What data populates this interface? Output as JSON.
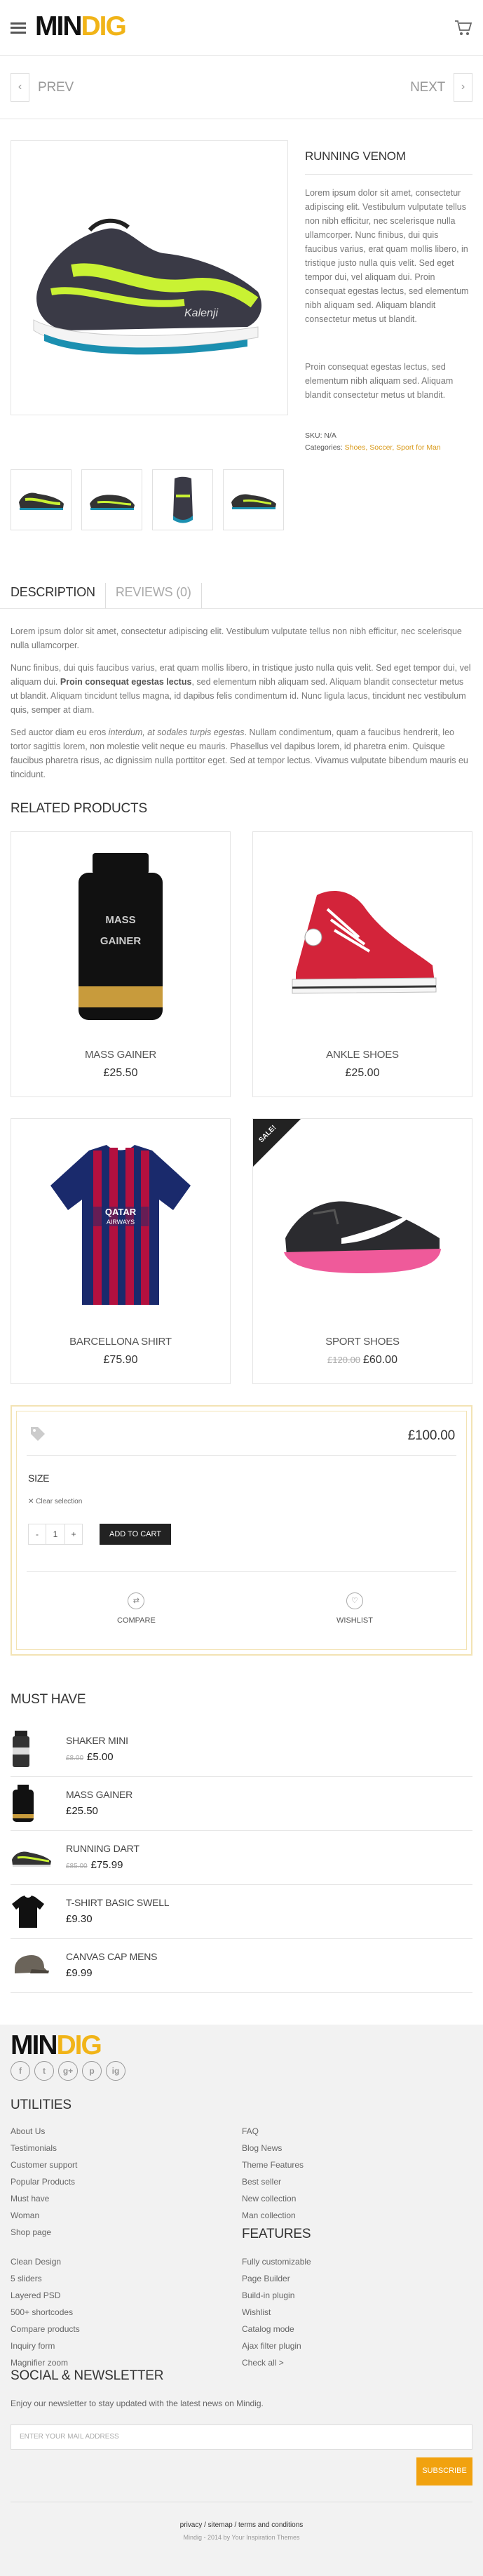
{
  "header": {
    "logo_a": "MIN",
    "logo_b": "DIG",
    "menu_icon": "hamburger-icon",
    "cart_icon": "shopping-cart-icon"
  },
  "nav": {
    "prev": "PREV",
    "next": "NEXT"
  },
  "product": {
    "title": "RUNNING VENOM",
    "desc1": "Lorem ipsum dolor sit amet, consectetur adipiscing elit. Vestibulum vulputate tellus non nibh efficitur, nec scelerisque nulla ullamcorper. Nunc finibus, dui quis faucibus varius, erat quam mollis libero, in tristique justo nulla quis velit. Sed eget tempor dui, vel aliquam dui. Proin consequat egestas lectus, sed elementum nibh aliquam sed. Aliquam blandit consectetur metus ut blandit.",
    "desc2": "Proin consequat egestas lectus, sed elementum nibh aliquam sed. Aliquam blandit consectetur metus ut blandit.",
    "sku_label": "SKU: N/A",
    "cat_label": "Categories:",
    "categories": "Shoes, Soccer, Sport for Man"
  },
  "tabs": {
    "description": "DESCRIPTION",
    "reviews": "REVIEWS (0)"
  },
  "description": {
    "p1": "Lorem ipsum dolor sit amet, consectetur adipiscing elit. Vestibulum vulputate tellus non nibh efficitur, nec scelerisque nulla ullamcorper.",
    "p2a": "Nunc finibus, dui quis faucibus varius, erat quam mollis libero, in tristique justo nulla quis velit. Sed eget tempor dui, vel aliquam dui. ",
    "p2b": "Proin consequat egestas lectus",
    "p2c": ", sed elementum nibh aliquam sed. Aliquam blandit consectetur metus ut blandit. Aliquam tincidunt tellus magna, id dapibus felis condimentum id. Nunc ligula lacus, tincidunt nec vestibulum quis, semper at diam.",
    "p3a": "Sed auctor diam eu eros ",
    "p3b": "interdum, at sodales turpis egestas",
    "p3c": ". Nullam condimentum, quam a faucibus hendrerit, leo tortor sagittis lorem, non molestie velit neque eu mauris. Phasellus vel dapibus lorem, id pharetra enim. Quisque faucibus pharetra risus, ac dignissim nulla porttitor eget. Sed at tempor lectus. Vivamus vulputate bibendum mauris eu tincidunt."
  },
  "related": {
    "title": "RELATED PRODUCTS",
    "items": [
      {
        "name": "MASS GAINER",
        "price": "£25.50"
      },
      {
        "name": "ANKLE SHOES",
        "price": "£25.00"
      },
      {
        "name": "BARCELLONA SHIRT",
        "price": "£75.90"
      },
      {
        "name": "SPORT SHOES",
        "old_price": "£120.00",
        "price": "£60.00",
        "badge": "SALE!"
      }
    ]
  },
  "buy": {
    "price": "£100.00",
    "size_label": "SIZE",
    "clear": "✕ Clear selection",
    "qty": "1",
    "minus": "-",
    "plus": "+",
    "add_to_cart": "ADD TO CART",
    "compare": "COMPARE",
    "wishlist": "WISHLIST"
  },
  "must_have": {
    "title": "MUST HAVE",
    "items": [
      {
        "name": "SHAKER MINI",
        "old_price": "£8.00",
        "price": "£5.00"
      },
      {
        "name": "MASS GAINER",
        "old_price": "",
        "price": "£25.50"
      },
      {
        "name": "RUNNING DART",
        "old_price": "£85.00",
        "price": "£75.99"
      },
      {
        "name": "T-SHIRT BASIC SWELL",
        "old_price": "",
        "price": "£9.30"
      },
      {
        "name": "CANVAS CAP MENS",
        "old_price": "",
        "price": "£9.99"
      }
    ]
  },
  "footer": {
    "logo_a": "MIN",
    "logo_b": "DIG",
    "social": [
      "f",
      "t",
      "g+",
      "p",
      "ig"
    ],
    "utilities_title": "UTILITIES",
    "col1": [
      "About Us",
      "Testimonials",
      "Customer support",
      "Popular Products",
      "Must have",
      "Woman",
      "Shop page"
    ],
    "col2": [
      "FAQ",
      "Blog News",
      "Theme Features",
      "Best seller",
      "New collection",
      "Man collection"
    ],
    "features_title": "FEATURES",
    "col3": [
      "Clean Design",
      "5 sliders",
      "Layered PSD",
      "500+ shortcodes",
      "Compare products",
      "Inquiry form",
      "Magnifier zoom"
    ],
    "col4": [
      "Fully customizable",
      "Page Builder",
      "Build-in plugin",
      "Wishlist",
      "Catalog mode",
      "Ajax filter plugin",
      "Check all >"
    ],
    "newsletter_title": "SOCIAL & NEWSLETTER",
    "newsletter_text": "Enjoy our newsletter to stay updated with the latest news on Mindig.",
    "email_placeholder": "ENTER YOUR MAIL ADDRESS",
    "subscribe": "SUBSCRIBE",
    "links": "privacy / sitemap / terms and conditions",
    "copyright": "Mindig - 2014 by Your Inspiration Themes"
  }
}
